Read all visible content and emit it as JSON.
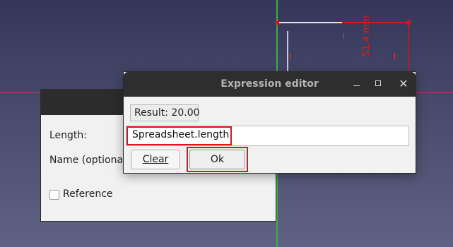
{
  "sketch": {
    "dimension_label": "51.4 mm"
  },
  "task_panel": {
    "length_label": "Length:",
    "name_label": "Name (optional)",
    "reference_label": "Reference"
  },
  "dialog": {
    "title": "Expression editor",
    "result_text": "Result: 20.00",
    "expression_value": "Spreadsheet.length",
    "clear_label": "Clear",
    "ok_label": "Ok",
    "minimize_icon": "minimize-icon",
    "maximize_icon": "maximize-icon",
    "close_icon": "close-icon"
  },
  "colors": {
    "highlight": "#e8101a",
    "x_axis": "#c0353a",
    "y_axis": "#35b23a"
  }
}
